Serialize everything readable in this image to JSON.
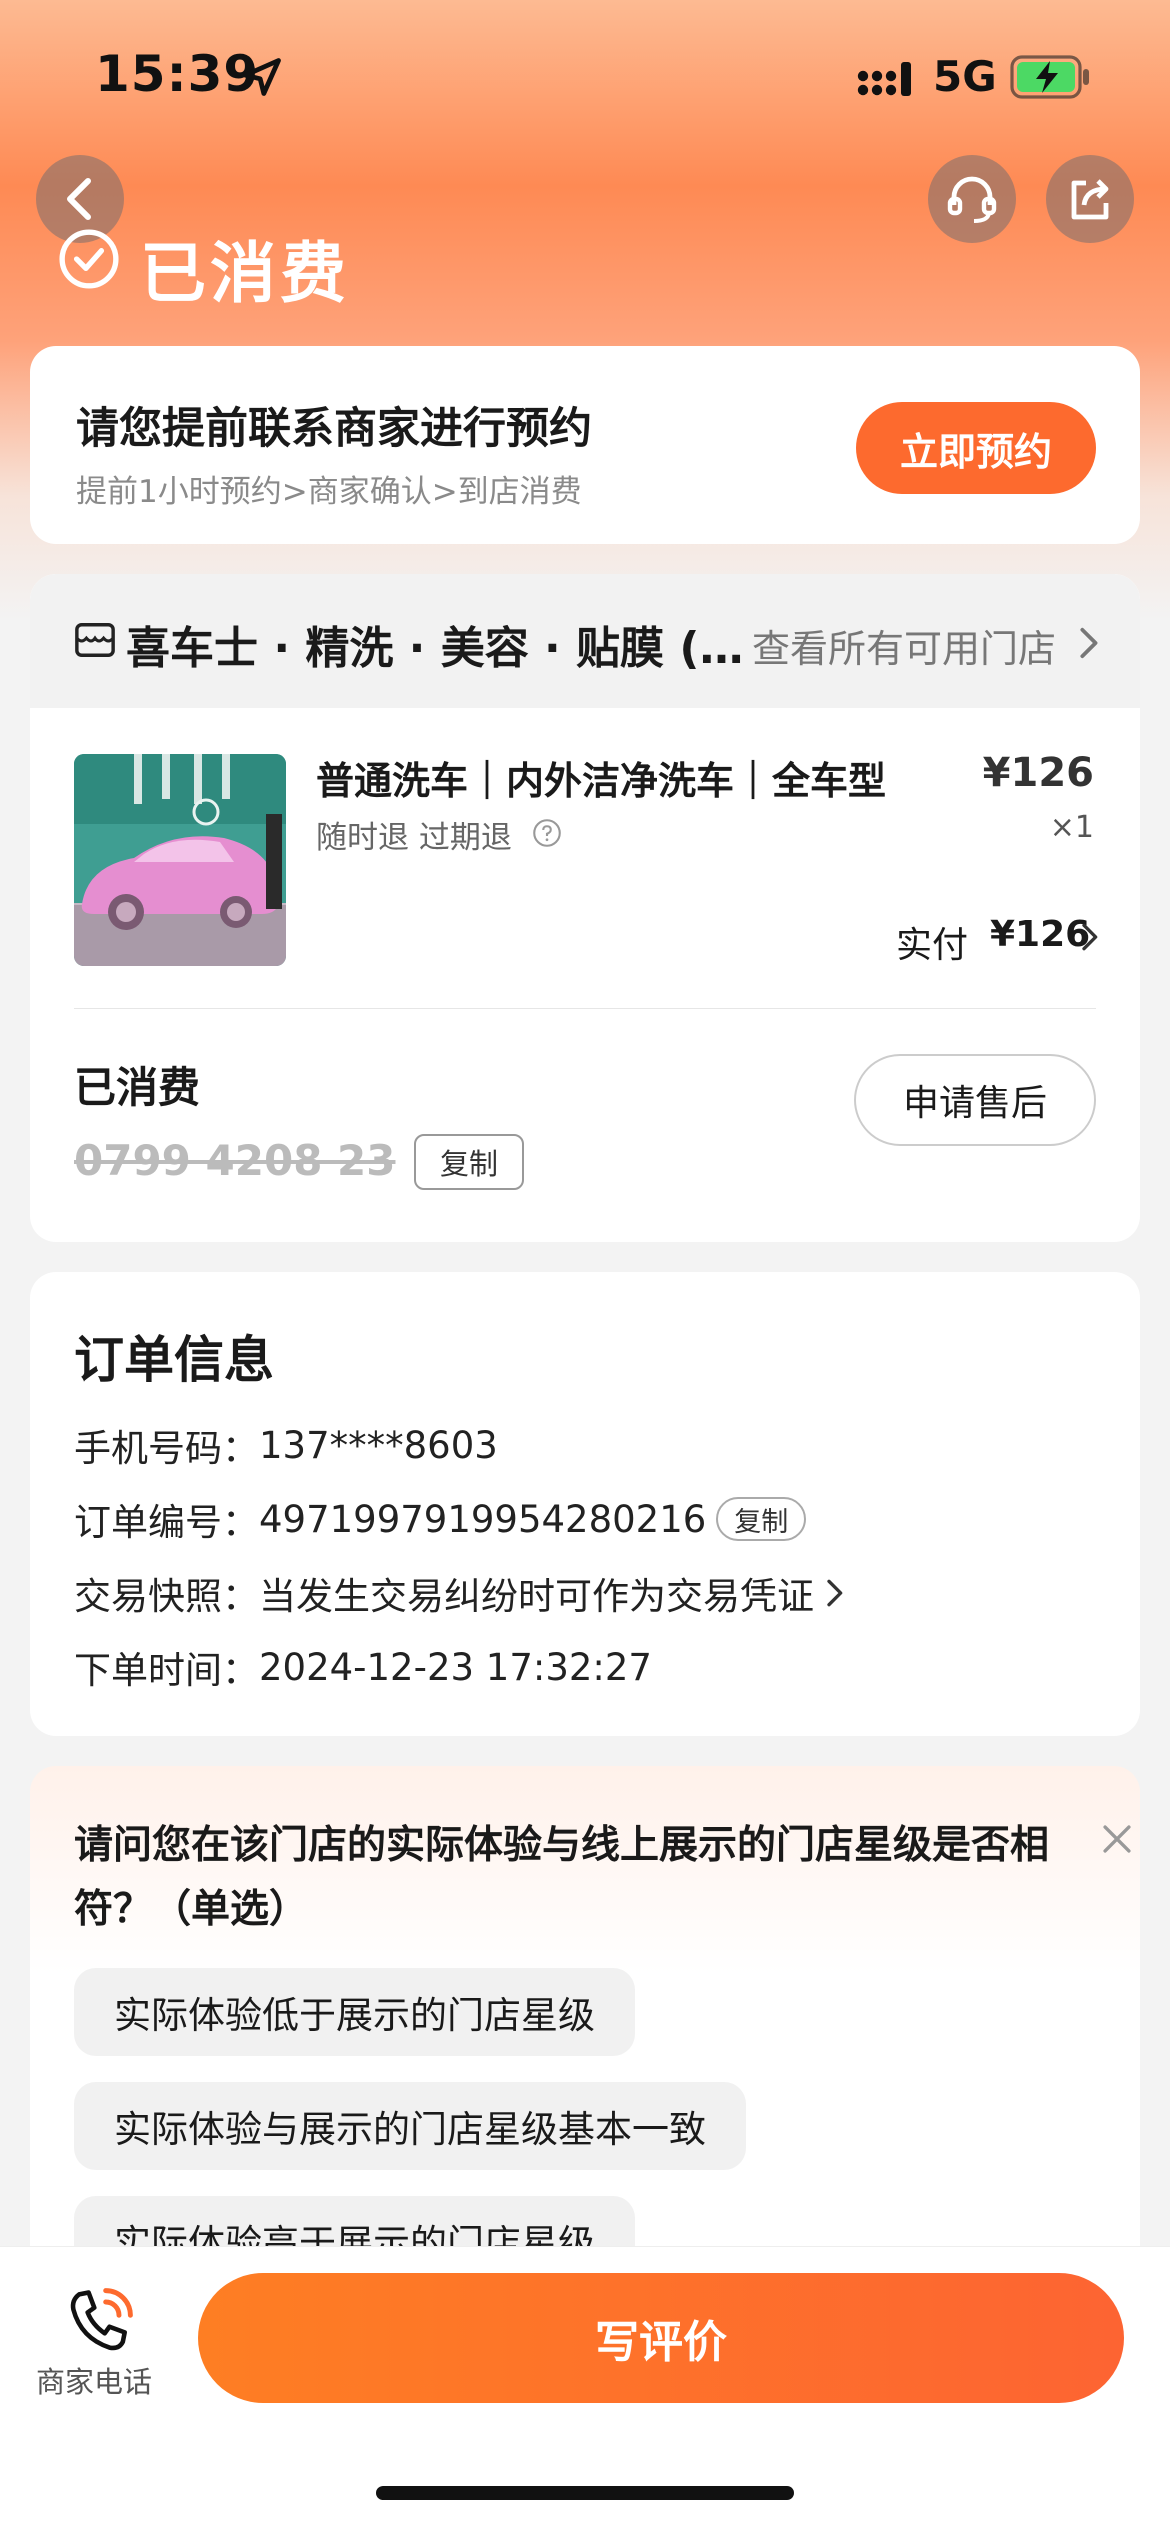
{
  "status_bar": {
    "time": "15:39",
    "network": "5G"
  },
  "header": {
    "title": "已消费"
  },
  "appointment": {
    "title": "请您提前联系商家进行预约",
    "subtitle": "提前1小时预约>商家确认>到店消费",
    "button": "立即预约"
  },
  "order_card": {
    "store_name": "喜车士 · 精洗 · 美容 · 贴膜 (…",
    "store_link": "查看所有可用门店",
    "product": {
      "title": "普通洗车｜内外洁净洗车｜全车型",
      "tags": "随时退  过期退",
      "price": "¥126",
      "qty": "×1",
      "paid_label": "实付",
      "paid_value": "¥126"
    },
    "used_label": "已消费",
    "voucher_code": "0799 4208 23",
    "copy_label": "复制",
    "aftersale_button": "申请售后"
  },
  "order_info": {
    "title": "订单信息",
    "rows": [
      {
        "label": "手机号码：",
        "value": "137****8603"
      },
      {
        "label": "订单编号：",
        "value": "4971997919954280216"
      },
      {
        "label": "交易快照：",
        "value": "当发生交易纠纷时可作为交易凭证"
      },
      {
        "label": "下单时间：",
        "value": "2024-12-23 17:32:27"
      }
    ],
    "copy_label": "复制"
  },
  "survey": {
    "question": "请问您在该门店的实际体验与线上展示的门店星级是否相符？（单选）",
    "options": [
      "实际体验低于展示的门店星级",
      "实际体验与展示的门店星级基本一致",
      "实际体验高于展示的门店星级"
    ]
  },
  "bottom_bar": {
    "phone_label": "商家电话",
    "review_button": "写评价"
  },
  "colors": {
    "accent": "#fd6a2e",
    "hero_top": "#fdba92",
    "hero_mid": "#fe8a54"
  }
}
